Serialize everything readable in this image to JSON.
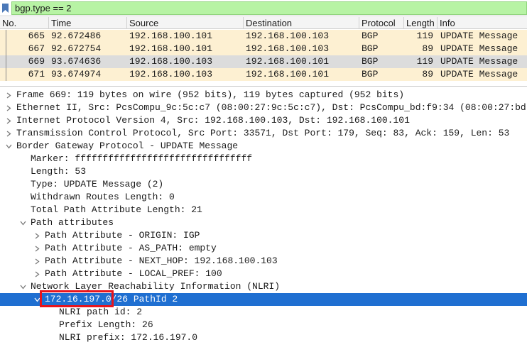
{
  "filter": {
    "value": "bgp.type == 2",
    "bookmark_icon": "bookmark-icon",
    "bg_color": "#b7f3a4"
  },
  "packet_list": {
    "columns": [
      "No.",
      "Time",
      "Source",
      "Destination",
      "Protocol",
      "Length",
      "Info"
    ],
    "rows": [
      {
        "no": "665",
        "time": "92.672486",
        "source": "192.168.100.101",
        "destination": "192.168.100.103",
        "protocol": "BGP",
        "length": "119",
        "info": "UPDATE Message",
        "bg": "#fdf0d2"
      },
      {
        "no": "667",
        "time": "92.672754",
        "source": "192.168.100.101",
        "destination": "192.168.100.103",
        "protocol": "BGP",
        "length": "89",
        "info": "UPDATE Message",
        "bg": "#fdf0d2"
      },
      {
        "no": "669",
        "time": "93.674636",
        "source": "192.168.100.103",
        "destination": "192.168.100.101",
        "protocol": "BGP",
        "length": "119",
        "info": "UPDATE Message",
        "bg": "#dcdcdc"
      },
      {
        "no": "671",
        "time": "93.674974",
        "source": "192.168.100.103",
        "destination": "192.168.100.101",
        "protocol": "BGP",
        "length": "89",
        "info": "UPDATE Message",
        "bg": "#fdf0d2"
      }
    ]
  },
  "detail_tree": [
    {
      "text": "Frame 669: 119 bytes on wire (952 bits), 119 bytes captured (952 bits)",
      "level": 0,
      "state": "collapsed"
    },
    {
      "text": "Ethernet II, Src: PcsCompu_9c:5c:c7 (08:00:27:9c:5c:c7), Dst: PcsCompu_bd:f9:34 (08:00:27:bd",
      "level": 0,
      "state": "collapsed"
    },
    {
      "text": "Internet Protocol Version 4, Src: 192.168.100.103, Dst: 192.168.100.101",
      "level": 0,
      "state": "collapsed"
    },
    {
      "text": "Transmission Control Protocol, Src Port: 33571, Dst Port: 179, Seq: 83, Ack: 159, Len: 53",
      "level": 0,
      "state": "collapsed"
    },
    {
      "text": "Border Gateway Protocol - UPDATE Message",
      "level": 0,
      "state": "expanded"
    },
    {
      "text": "Marker: ffffffffffffffffffffffffffffffff",
      "level": 1,
      "state": "leaf"
    },
    {
      "text": "Length: 53",
      "level": 1,
      "state": "leaf"
    },
    {
      "text": "Type: UPDATE Message (2)",
      "level": 1,
      "state": "leaf"
    },
    {
      "text": "Withdrawn Routes Length: 0",
      "level": 1,
      "state": "leaf"
    },
    {
      "text": "Total Path Attribute Length: 21",
      "level": 1,
      "state": "leaf"
    },
    {
      "text": "Path attributes",
      "level": 1,
      "state": "expanded"
    },
    {
      "text": "Path Attribute - ORIGIN: IGP",
      "level": 2,
      "state": "collapsed"
    },
    {
      "text": "Path Attribute - AS_PATH: empty",
      "level": 2,
      "state": "collapsed"
    },
    {
      "text": "Path Attribute - NEXT_HOP: 192.168.100.103",
      "level": 2,
      "state": "collapsed"
    },
    {
      "text": "Path Attribute - LOCAL_PREF: 100",
      "level": 2,
      "state": "collapsed"
    },
    {
      "text": "Network Layer Reachability Information (NLRI)",
      "level": 1,
      "state": "expanded"
    },
    {
      "text": "172.16.197.0/26 PathId 2",
      "level": 2,
      "state": "expanded",
      "selected": true,
      "highlighted": "172.16.197.0/26"
    },
    {
      "text": "NLRI path id: 2",
      "level": 3,
      "state": "leaf"
    },
    {
      "text": "Prefix Length: 26",
      "level": 3,
      "state": "leaf"
    },
    {
      "text": "NLRI prefix: 172.16.197.0",
      "level": 3,
      "state": "leaf"
    }
  ],
  "colors": {
    "selection": "#1f6fd1",
    "annotation": "#e8141c",
    "row_normal": "#fdf0d2",
    "row_current": "#dcdcdc"
  }
}
